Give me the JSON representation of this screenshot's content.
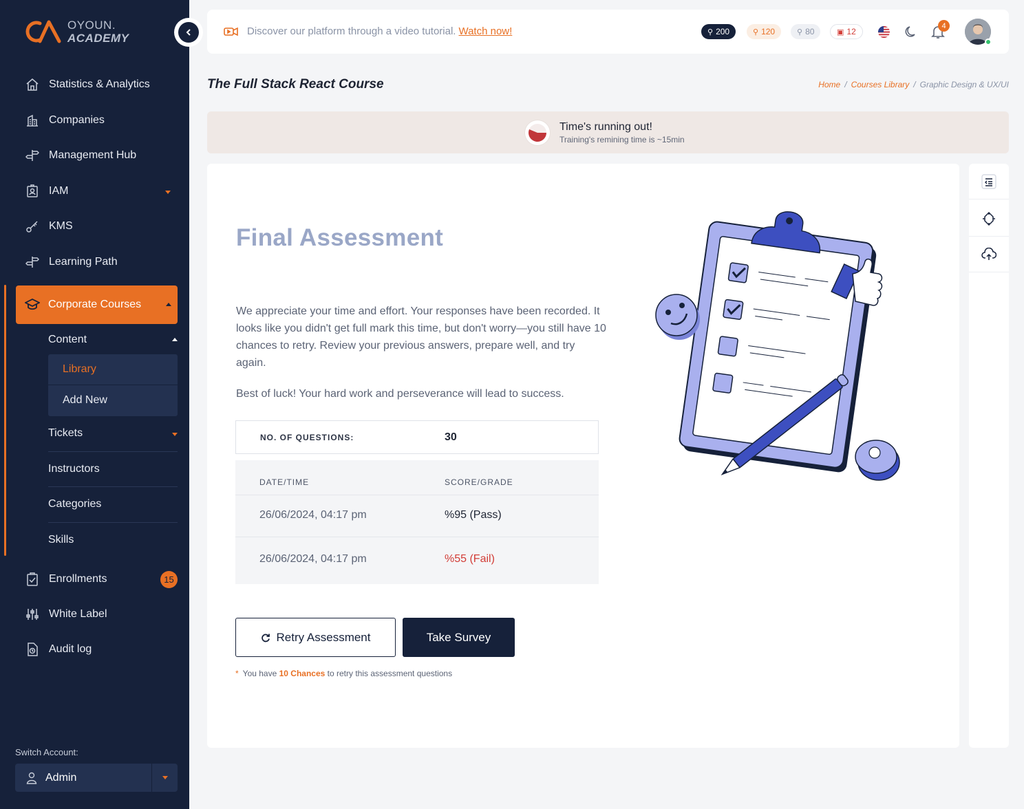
{
  "brand": {
    "line1": "OYOUN.",
    "line2": "ACADEMY",
    "accent": "#e87024",
    "sidebar_bg": "#16213a"
  },
  "sidebar": {
    "items": [
      {
        "label": "Statistics & Analytics",
        "icon": "home-icon"
      },
      {
        "label": "Companies",
        "icon": "building-icon"
      },
      {
        "label": "Management Hub",
        "icon": "signpost-icon"
      },
      {
        "label": "IAM",
        "icon": "id-badge-icon"
      },
      {
        "label": "KMS",
        "icon": "key-icon"
      },
      {
        "label": "Learning Path",
        "icon": "signpost-icon"
      }
    ],
    "active": {
      "label": "Corporate Courses",
      "icon": "graduation-cap-icon"
    },
    "content_label": "Content",
    "content_sub": [
      {
        "label": "Library"
      },
      {
        "label": "Add New"
      }
    ],
    "sub_items": [
      {
        "label": "Tickets"
      },
      {
        "label": "Instructors"
      },
      {
        "label": "Categories"
      },
      {
        "label": "Skills"
      }
    ],
    "bottom_items": [
      {
        "label": "Enrollments",
        "icon": "clipboard-check-icon",
        "badge": "15"
      },
      {
        "label": "White Label",
        "icon": "sliders-icon"
      },
      {
        "label": "Audit log",
        "icon": "document-clock-icon"
      }
    ],
    "switch_account_label": "Switch Account:",
    "account": "Admin"
  },
  "topbar": {
    "promo_text": "Discover our platform through a video tutorial.",
    "promo_link": "Watch now!",
    "pills": [
      {
        "value": "200",
        "style": "dark"
      },
      {
        "value": "120",
        "style": "orange"
      },
      {
        "value": "80",
        "style": "gray"
      },
      {
        "value": "12",
        "style": "red"
      }
    ],
    "notifications": "4"
  },
  "page": {
    "title": "The Full Stack React Course",
    "breadcrumb": {
      "home": "Home",
      "library": "Courses Library",
      "current": "Graphic Design & UX/UI",
      "sep": "/"
    }
  },
  "alert": {
    "title": "Time's running out!",
    "subtitle": "Training's remining time is ~15min"
  },
  "assessment": {
    "title": "Final Assessment",
    "paragraph": "We appreciate your time and effort. Your responses have been recorded. It looks like you didn't get full mark this time, but don't worry—you still have 10 chances to retry. Review your previous answers, prepare well, and try again.",
    "paragraph2": "Best of luck! Your hard work and perseverance will lead to success.",
    "questions_label": "NO. OF QUESTIONS:",
    "questions_value": "30",
    "table_headers": [
      "DATE/TIME",
      "SCORE/GRADE"
    ],
    "attempts": [
      {
        "date": "26/06/2024, 04:17 pm",
        "score": "%95 (Pass)",
        "status": "pass"
      },
      {
        "date": "26/06/2024, 04:17 pm",
        "score": "%55 (Fail)",
        "status": "fail"
      }
    ],
    "retry_label": "Retry Assessment",
    "survey_label": "Take Survey",
    "note_prefix": "You have",
    "note_highlight": "10 Chances",
    "note_suffix": "to retry this assessment questions",
    "asterisk": "*"
  }
}
